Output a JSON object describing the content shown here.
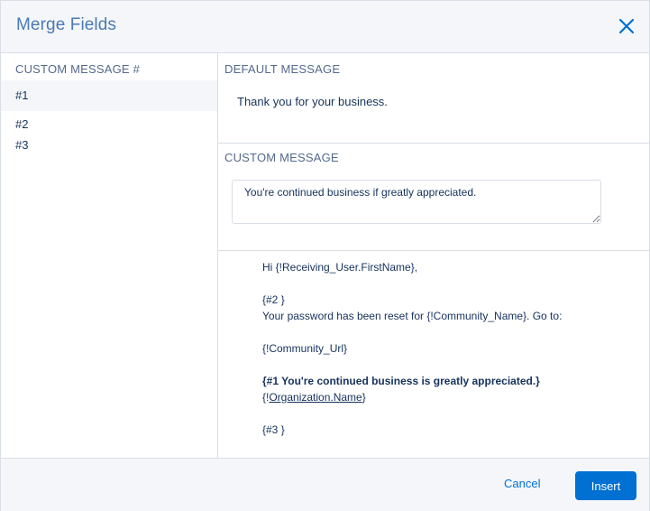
{
  "header": {
    "title": "Merge Fields",
    "close_icon": "close-icon"
  },
  "sidebar": {
    "heading": "CUSTOM MESSAGE #",
    "items": [
      {
        "label": "#1",
        "selected": true
      },
      {
        "label": "#2",
        "selected": false
      },
      {
        "label": "#3",
        "selected": false
      }
    ]
  },
  "main": {
    "default_heading": "DEFAULT MESSAGE",
    "default_text": "Thank you for your business.",
    "custom_heading": "CUSTOM MESSAGE",
    "custom_value": "You're continued business if greatly appreciated.",
    "preview": {
      "greeting": "Hi {!Receiving_User.FirstName},",
      "slot2": "{#2 }",
      "password_line": "Your password has been reset for {!Community_Name}. Go to:",
      "community_url": "{!Community_Url}",
      "slot1_bold": "{#1 You're continued business is greatly appreciated.}",
      "org_prefix": "{!",
      "org_name": "Organization.Name",
      "org_suffix": "}",
      "slot3": "{#3 }"
    }
  },
  "footer": {
    "cancel_label": "Cancel",
    "insert_label": "Insert"
  },
  "colors": {
    "brand_blue": "#0070d2",
    "title_blue": "#4a79b6",
    "header_bg": "#f4f6f9",
    "border": "#d8dde6",
    "label_gray": "#54698d"
  }
}
